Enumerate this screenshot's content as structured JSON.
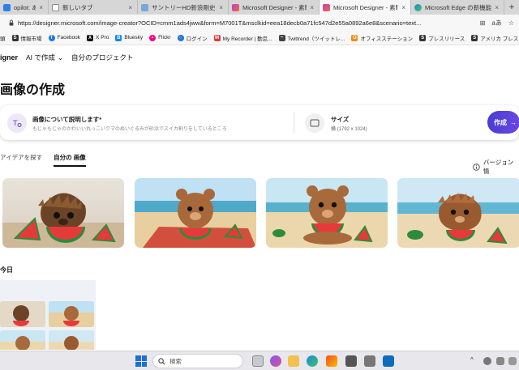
{
  "browser": {
    "tabs": [
      {
        "label": "opilot: あなたの AI",
        "favicon_color": "#2f7fe8",
        "active": false
      },
      {
        "label": "新しいタブ",
        "favicon_color": "#8a8a8a",
        "active": false
      },
      {
        "label": "サントリーHD新浪剛史会長が辞",
        "favicon_color": "#7aa7d8",
        "active": false
      },
      {
        "label": "Microsoft Designer - 素晴らし",
        "favicon_color": "#c23bd4",
        "active": false
      },
      {
        "label": "Microsoft Designer - 素晴らし",
        "favicon_color": "#c23bd4",
        "active": true
      },
      {
        "label": "Microsoft Edge の新機能",
        "favicon_color": "#1f88d8",
        "active": false
      }
    ],
    "close_glyph": "×",
    "new_tab_glyph": "+",
    "url": "https://designer.microsoft.com/image-creator?OCID=cmm1ads4jww&form=M7001T&msclkid=eea18decb0a71fc547d2e55a0892a6e8&scenario=text...",
    "read_aloud": "aあ"
  },
  "favorites": [
    {
      "label": "頭",
      "icon_color": "#555555",
      "icon": "S"
    },
    {
      "label": "情報市場",
      "icon_color": "#333333",
      "icon": "S"
    },
    {
      "label": "Facebook",
      "icon_color": "#1877f2",
      "icon": "f"
    },
    {
      "label": "X Pro",
      "icon_color": "#111111",
      "icon": "X"
    },
    {
      "label": "Bluesky",
      "icon_color": "#1185fe",
      "icon": "B"
    },
    {
      "label": "Flickr",
      "icon_color": "#ff0084",
      "icon": "•"
    },
    {
      "label": "ログイン",
      "icon_color": "#1f6fd6",
      "icon": "○"
    },
    {
      "label": "My Recorder | 勤怠...",
      "icon_color": "#e03a3a",
      "icon": "M"
    },
    {
      "label": "Twittrend（ツイットレ...",
      "icon_color": "#444444",
      "icon": "~"
    },
    {
      "label": "オフィスステーション",
      "icon_color": "#f08a1e",
      "icon": "O"
    },
    {
      "label": "プレスリリース",
      "icon_color": "#333333",
      "icon": "S"
    },
    {
      "label": "アメリカ プレスリリース...",
      "icon_color": "#333333",
      "icon": "S"
    }
  ],
  "app": {
    "brand": "igner",
    "nav": [
      {
        "label": "AI で作成",
        "caret": "⌄"
      },
      {
        "label": "自分のプロジェクト",
        "caret": ""
      }
    ],
    "page_title": "画像の作成"
  },
  "prompt": {
    "title": "画像について説明します",
    "required_mark": "*",
    "placeholder": "もじゃもじゃのかわいい丸っこいクマのぬいぐるみが砂浜でスイカ割りをしているところ",
    "size_label": "サイズ",
    "size_value": "横 (1792 x 1024)",
    "create_label": "作成",
    "create_arrow": "→"
  },
  "content_tabs": [
    {
      "label": "アイデアを探す",
      "active": false
    },
    {
      "label": "自分の 画像",
      "active": true
    }
  ],
  "version_info": "バージョン情",
  "images": [
    {
      "name": "hedgehog-bear-watermelon"
    },
    {
      "name": "bear-on-towel-watermelon"
    },
    {
      "name": "bear-eating-watermelon"
    },
    {
      "name": "fluffy-bear-watermelon"
    }
  ],
  "section_today": "今日",
  "taskbar": {
    "search_placeholder": "検索",
    "chevron": "^"
  },
  "colors": {
    "accent": "#4a3bd6",
    "tab_active": "#f7f7f7",
    "tab_strip": "#d6d6d6"
  }
}
